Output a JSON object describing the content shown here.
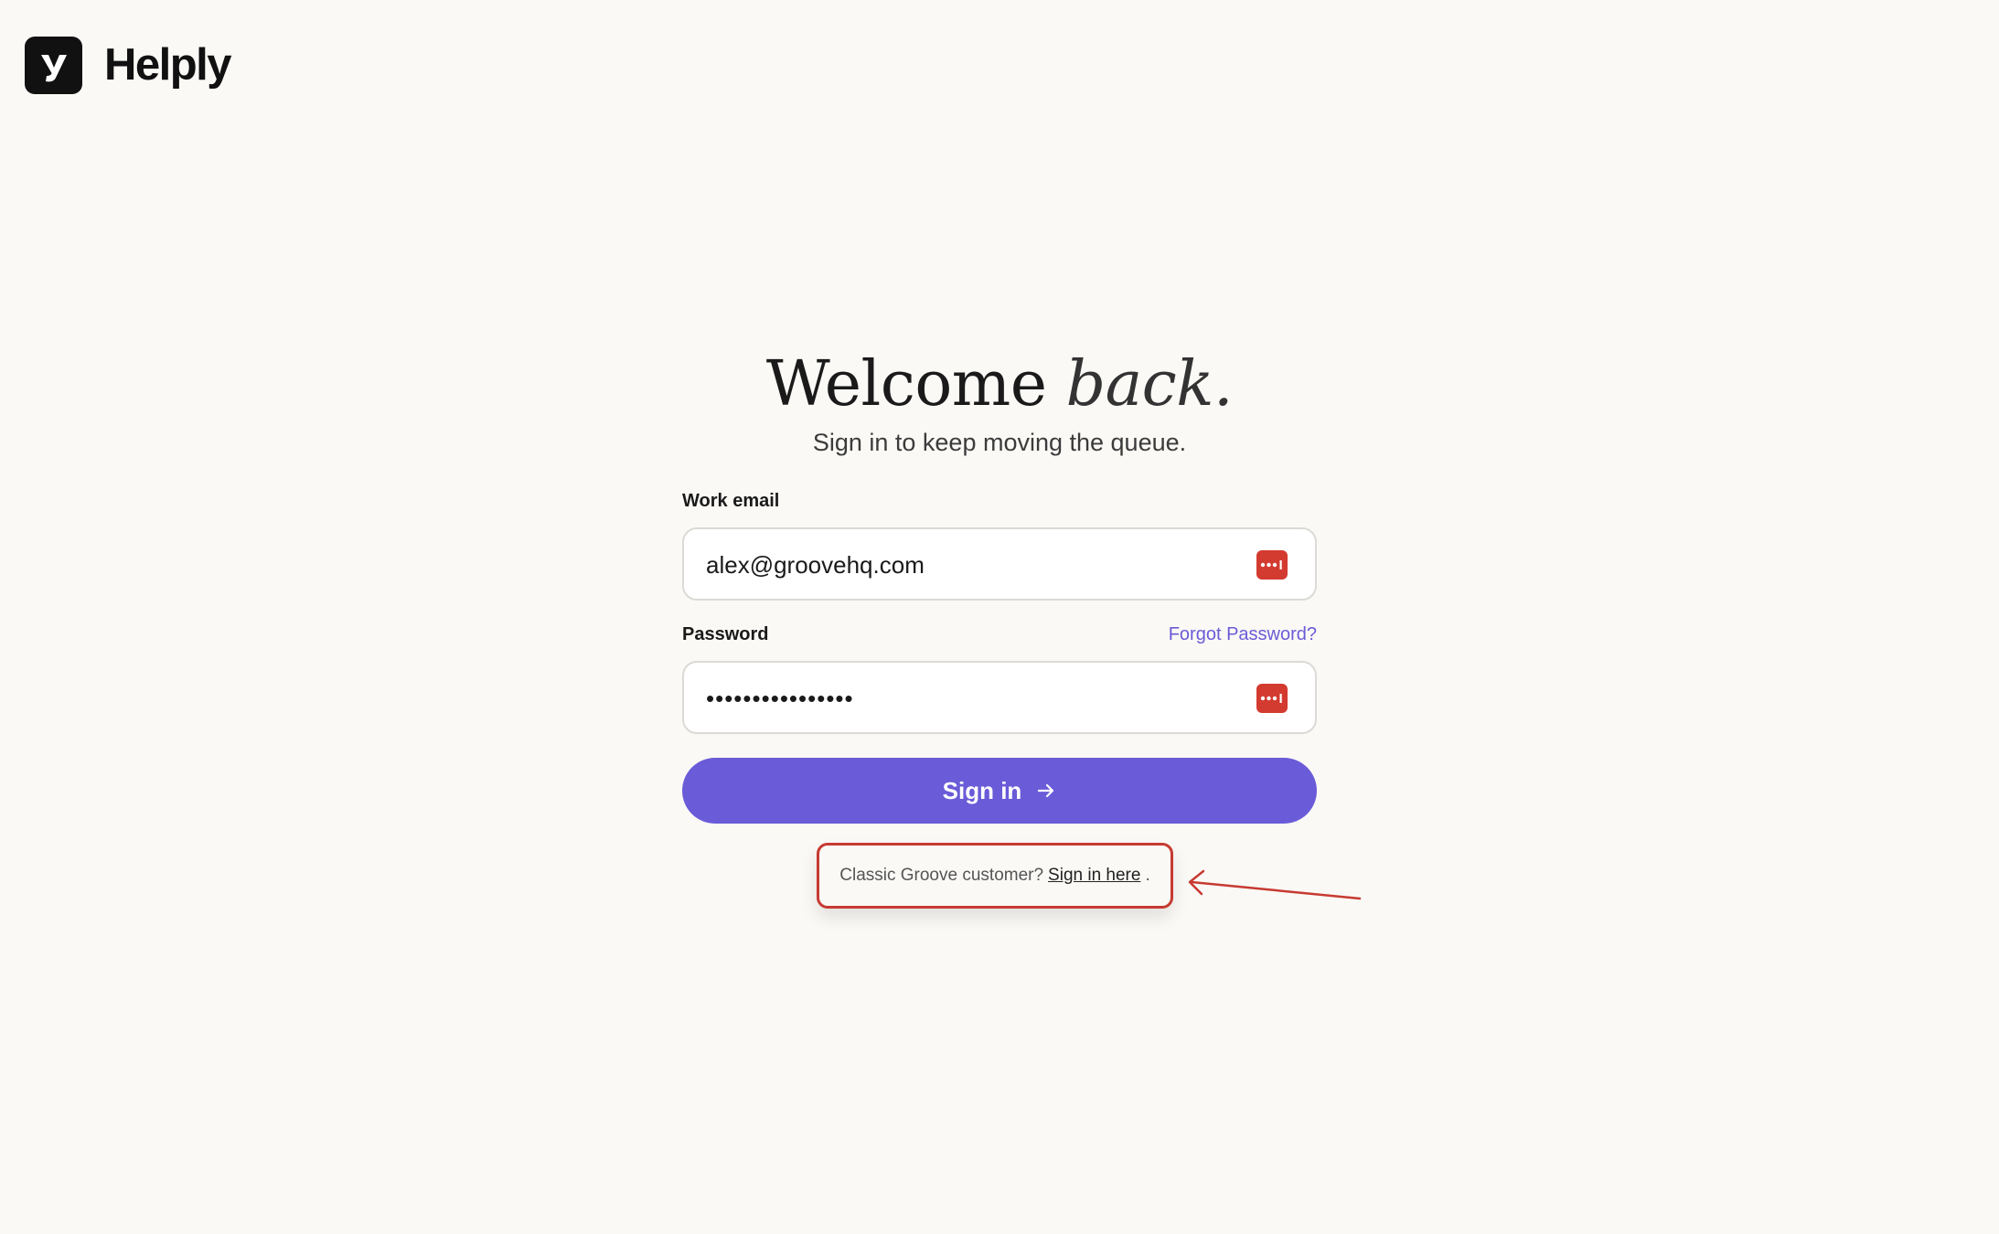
{
  "brand": {
    "name": "Helply"
  },
  "heading": {
    "main": "Welcome",
    "emphasis": "back."
  },
  "subheading": "Sign in to keep moving the queue.",
  "form": {
    "email": {
      "label": "Work email",
      "value": "alex@groovehq.com"
    },
    "password": {
      "label": "Password",
      "value": "••••••••••••••••",
      "forgot_label": "Forgot Password?"
    },
    "submit_label": "Sign in"
  },
  "classic": {
    "lead": "Classic Groove customer?",
    "link_label": "Sign in here",
    "trailing": "."
  },
  "colors": {
    "background": "#faf9f6",
    "accent": "#6a5bd8",
    "link": "#6a5bd6",
    "annotation": "#c73a31",
    "password_manager_icon": "#d33a30"
  },
  "icons": {
    "logo": "helply-logo-icon",
    "password_manager": "password-manager-icon",
    "submit_arrow": "arrow-right-icon",
    "annotation_arrow": "annotation-arrow-icon"
  }
}
